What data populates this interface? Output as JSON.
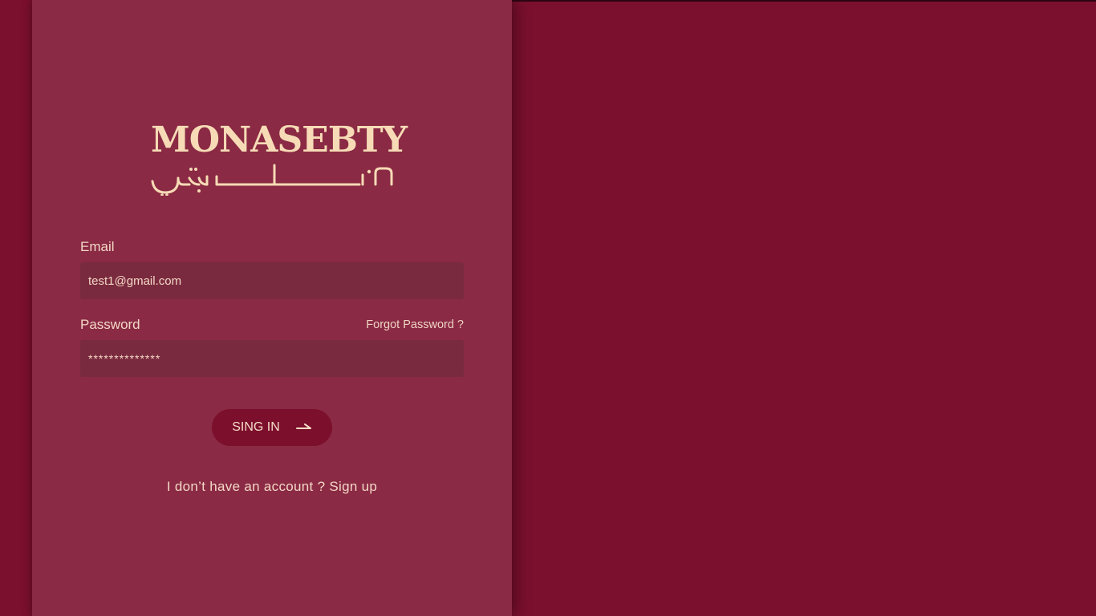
{
  "brand": {
    "name": "MONASEBTY",
    "name_arabic": "مناسبتي"
  },
  "form": {
    "email_label": "Email",
    "email_value": "test1@gmail.com",
    "password_label": "Password",
    "password_value": "**************",
    "forgot_password": "Forgot Password ?",
    "submit_label": "SING IN"
  },
  "footer": {
    "prompt": "I don’t have an account ?",
    "signup_link": "Sign up"
  },
  "icons": {
    "submit": "arrow-right-icon"
  },
  "colors": {
    "background": "#7b102e",
    "panel": "#8a2a44",
    "input": "#7a2a3e",
    "button": "#7b0f2c",
    "text": "#f3d7c6",
    "logo": "#f6dbb6"
  }
}
